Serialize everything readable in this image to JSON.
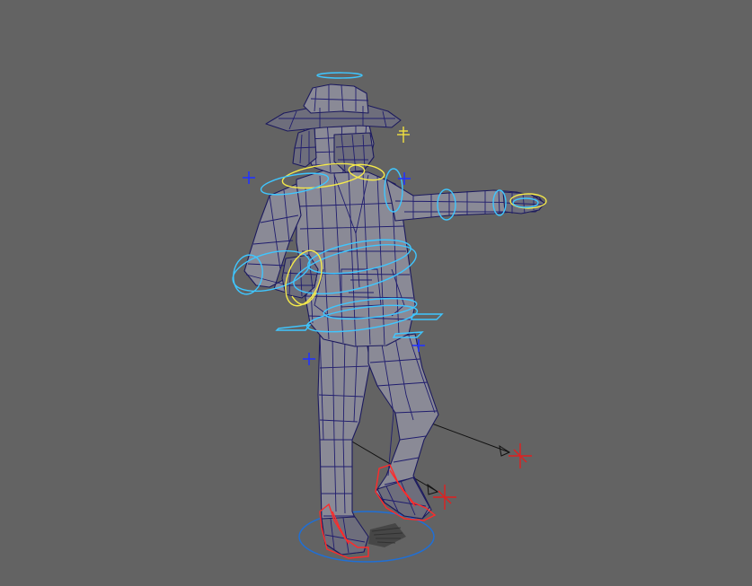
{
  "viewport": {
    "background": "#636363",
    "mesh_fill": "#8a8a96",
    "wire_color": "#1c1a5e"
  },
  "controls": {
    "fk_color": "#3fc6ff",
    "ik_color": "#f5ea4a",
    "foot_color": "#ff2a2a",
    "root_color": "#1f6fd6",
    "locator_color": "#2233ff",
    "pole_vector_color": "#e02020"
  },
  "icons": [
    "head-halo-control",
    "look-at-locator",
    "shoulder-locator-left",
    "shoulder-locator-right",
    "hip-locator-left",
    "hip-locator-right",
    "knee-pole-vector-left",
    "knee-pole-vector-right",
    "root-ground-control"
  ]
}
